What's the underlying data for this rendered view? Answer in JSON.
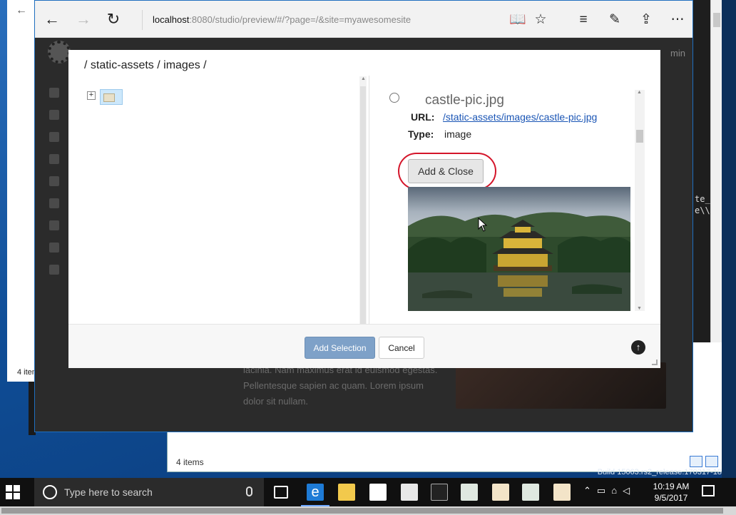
{
  "browser": {
    "url_host": "localhost",
    "url_rest": ":8080/studio/preview/#/?page=/&site=myawesomesite"
  },
  "background": {
    "admin_label": "min",
    "lorem": "lacinia. Nam maximus erat id euismod egestas. Pellentesque sapien ac quam. Lorem ipsum dolor sit nullam.",
    "explorer_items": "4 item",
    "back_items": "4 items",
    "code_line1": "te_",
    "code_line2": "e\\\\",
    "build": "Build 15063.rs2_release.170317-18"
  },
  "dialog": {
    "breadcrumb": "/ static-assets / images /",
    "file": {
      "name": "castle-pic.jpg",
      "url_label": "URL:",
      "url": "/static-assets/images/castle-pic.jpg",
      "type_label": "Type:",
      "type": "image",
      "add_close": "Add & Close"
    },
    "footer": {
      "add_selection": "Add Selection",
      "cancel": "Cancel"
    }
  },
  "taskbar": {
    "search_placeholder": "Type here to search",
    "time": "10:19 AM",
    "date": "9/5/2017"
  },
  "colors": {
    "accent": "#7ea1c8",
    "highlight": "#d4152a",
    "link": "#1a55b5"
  }
}
